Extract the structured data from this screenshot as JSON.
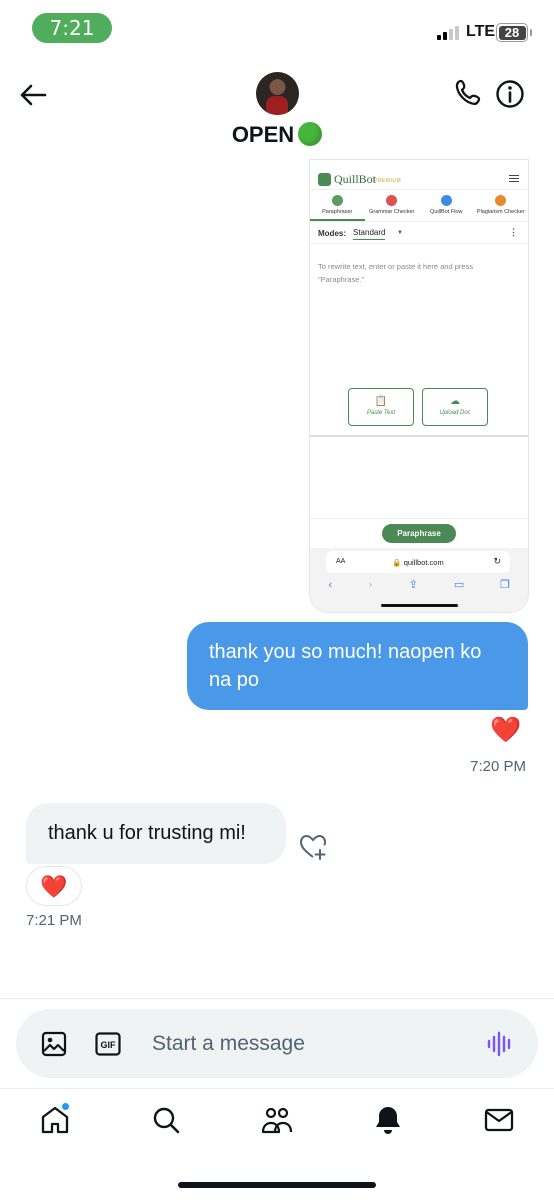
{
  "status_bar": {
    "time": "7:21",
    "network": "LTE",
    "battery": "28"
  },
  "header": {
    "contact_name": "OPEN",
    "icons": [
      "back-arrow-icon",
      "avatar",
      "phone-icon",
      "info-icon"
    ]
  },
  "shared_image": {
    "app_name": "QuillBot",
    "premium_label": "PREMIUM",
    "tabs": [
      "Paraphraser",
      "Grammar Checker",
      "QuillBot Flow",
      "Plagiarism Checker"
    ],
    "modes_label": "Modes:",
    "mode_value": "Standard",
    "placeholder": "To rewrite text, enter or paste it here and press \"Paraphrase.\"",
    "paste_button": "Paste Text",
    "upload_button": "Upload Doc",
    "paraphrase_button": "Paraphrase",
    "text_size_label": "AA",
    "url": "quillbot.com"
  },
  "messages": [
    {
      "direction": "outgoing",
      "text": "thank you so much! naopen ko na po",
      "reaction": "❤️",
      "time": "7:20 PM"
    },
    {
      "direction": "incoming",
      "text": "thank u for trusting mi!",
      "reaction": "❤️",
      "time": "7:21 PM"
    }
  ],
  "composer": {
    "placeholder": "Start a message",
    "gif_label": "GIF"
  },
  "bottom_nav": [
    "home-icon",
    "search-icon",
    "communities-icon",
    "notifications-icon",
    "messages-icon"
  ],
  "colors": {
    "outgoing_bubble": "#4a99e9",
    "incoming_bubble": "#eff3f4",
    "quillbot_green": "#4b8a55",
    "status_time_bg": "#4fad5b",
    "voice_accent": "#7856ff"
  }
}
